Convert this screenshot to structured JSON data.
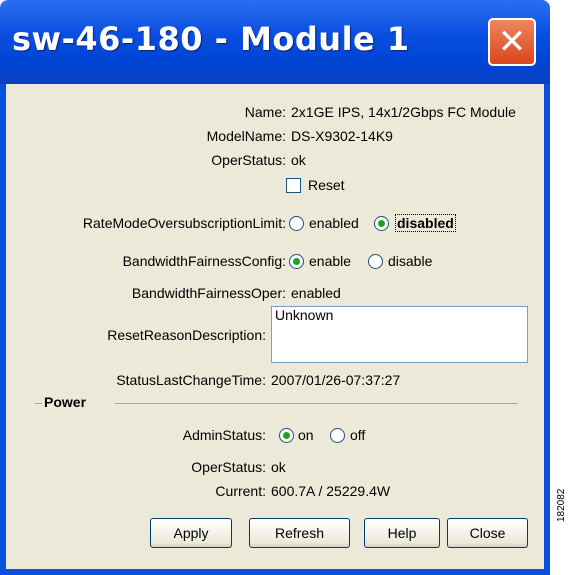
{
  "window": {
    "title": "sw-46-180 - Module 1"
  },
  "fields": {
    "name_label": "Name:",
    "name_value": "2x1GE IPS, 14x1/2Gbps FC Module",
    "model_label": "ModelName:",
    "model_value": "DS-X9302-14K9",
    "oper_label": "OperStatus:",
    "oper_value": "ok",
    "reset_label": "Reset",
    "rate_label": "RateModeOversubscriptionLimit:",
    "rate_opt1": "enabled",
    "rate_opt2": "disabled",
    "rate_selected": "disabled",
    "bwcfg_label": "BandwidthFairnessConfig:",
    "bwcfg_opt1": "enable",
    "bwcfg_opt2": "disable",
    "bwcfg_selected": "enable",
    "bwoper_label": "BandwidthFairnessOper:",
    "bwoper_value": "enabled",
    "resetreason_label": "ResetReasonDescription:",
    "resetreason_value": "Unknown",
    "statuschange_label": "StatusLastChangeTime:",
    "statuschange_value": "2007/01/26-07:37:27"
  },
  "power": {
    "legend": "Power",
    "admin_label": "AdminStatus:",
    "admin_opt1": "on",
    "admin_opt2": "off",
    "admin_selected": "on",
    "oper_label": "OperStatus:",
    "oper_value": "ok",
    "current_label": "Current:",
    "current_value": "600.7A / 25229.4W"
  },
  "buttons": {
    "apply": "Apply",
    "refresh": "Refresh",
    "help": "Help",
    "close": "Close"
  },
  "side_code": "182082",
  "colors": {
    "titlebar": "#0a4fe0",
    "client_bg": "#ece9d8",
    "radio_dot": "#21a121",
    "close_btn": "#d8461f"
  }
}
